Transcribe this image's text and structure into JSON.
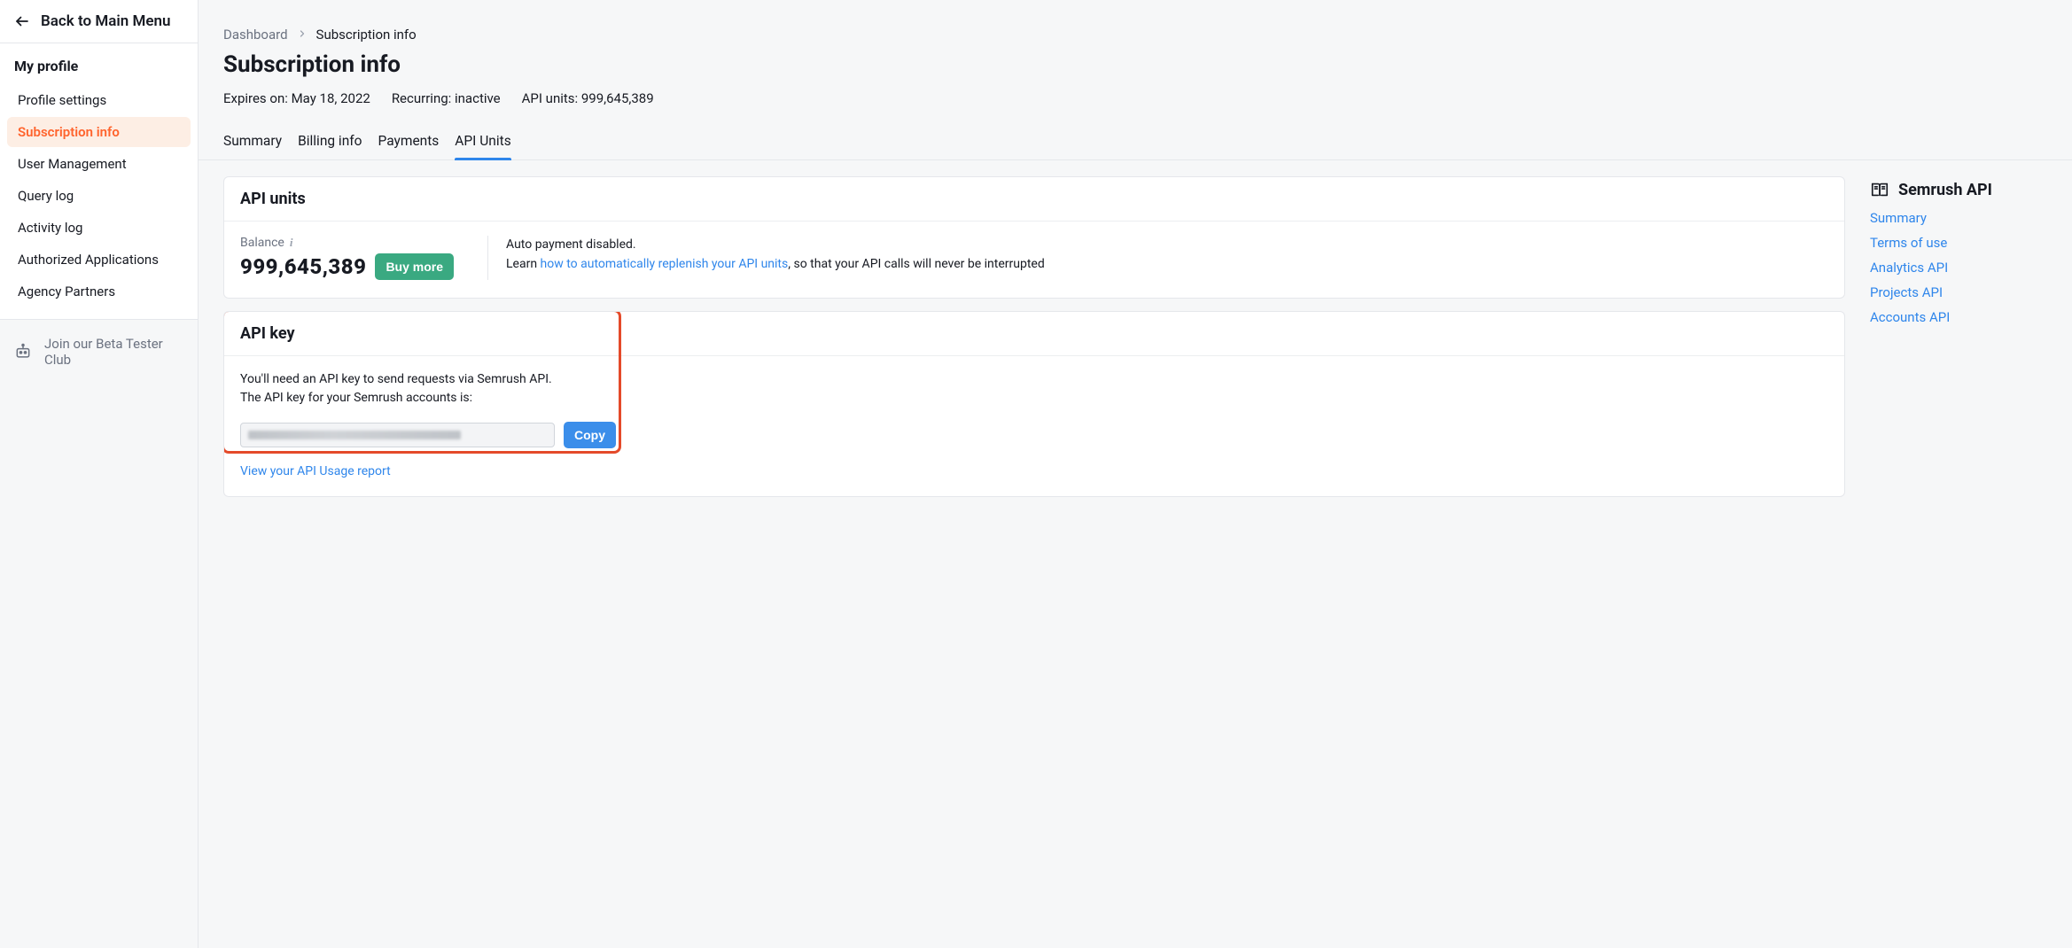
{
  "sidebar": {
    "back_label": "Back to Main Menu",
    "section_title": "My profile",
    "items": [
      {
        "label": "Profile settings",
        "active": false
      },
      {
        "label": "Subscription info",
        "active": true
      },
      {
        "label": "User Management",
        "active": false
      },
      {
        "label": "Query log",
        "active": false
      },
      {
        "label": "Activity log",
        "active": false
      },
      {
        "label": "Authorized Applications",
        "active": false
      },
      {
        "label": "Agency Partners",
        "active": false
      }
    ],
    "beta_label": "Join our Beta Tester Club"
  },
  "breadcrumb": {
    "root": "Dashboard",
    "current": "Subscription info"
  },
  "page_title": "Subscription info",
  "meta": {
    "expires": "Expires on: May 18, 2022",
    "recurring": "Recurring: inactive",
    "api_units": "API units: 999,645,389"
  },
  "tabs": [
    {
      "label": "Summary",
      "active": false
    },
    {
      "label": "Billing info",
      "active": false
    },
    {
      "label": "Payments",
      "active": false
    },
    {
      "label": "API Units",
      "active": true
    }
  ],
  "api_units_card": {
    "title": "API units",
    "balance_label": "Balance",
    "balance_value": "999,645,389",
    "buy_more": "Buy more",
    "auto_disabled": "Auto payment disabled.",
    "learn_prefix": "Learn ",
    "learn_link": "how to automatically replenish your API units",
    "learn_suffix": ", so that your API calls will never be interrupted"
  },
  "api_key_card": {
    "title": "API key",
    "desc1": "You'll need an API key to send requests via Semrush API.",
    "desc2": "The API key for your Semrush accounts is:",
    "copy": "Copy",
    "usage_link": "View your API Usage report"
  },
  "rail": {
    "title": "Semrush API",
    "links": [
      "Summary",
      "Terms of use",
      "Analytics API",
      "Projects API",
      "Accounts API"
    ]
  }
}
